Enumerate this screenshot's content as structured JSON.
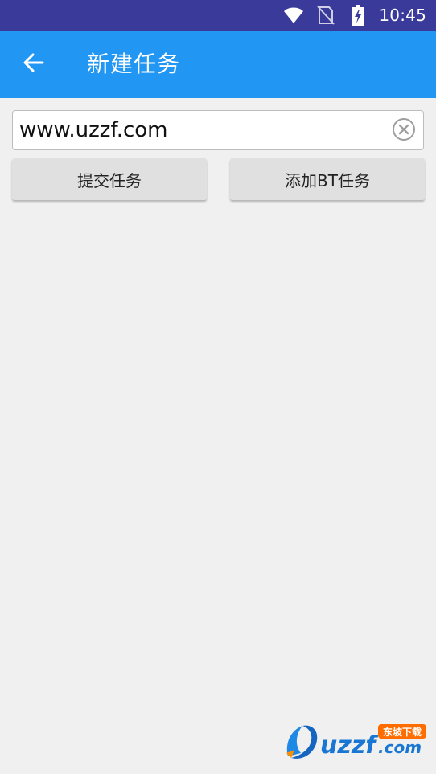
{
  "status_bar": {
    "time": "10:45",
    "icons": [
      "wifi-icon",
      "no-sim-icon",
      "battery-charging-icon"
    ]
  },
  "app_bar": {
    "title": "新建任务",
    "back_icon": "arrow-left-icon",
    "color": "#2196f3"
  },
  "url_field": {
    "value": "www.uzzf.com",
    "clear_icon": "clear-circle-icon"
  },
  "buttons": {
    "submit_label": "提交任务",
    "add_bt_label": "添加BT任务"
  },
  "watermark": {
    "logo_text": "uzzf.com",
    "badge_text": "东坡下载"
  },
  "colors": {
    "status_bar": "#3a3a9a",
    "app_bar": "#2196f3",
    "background": "#f0f0f0",
    "button": "#e0e0e0"
  }
}
